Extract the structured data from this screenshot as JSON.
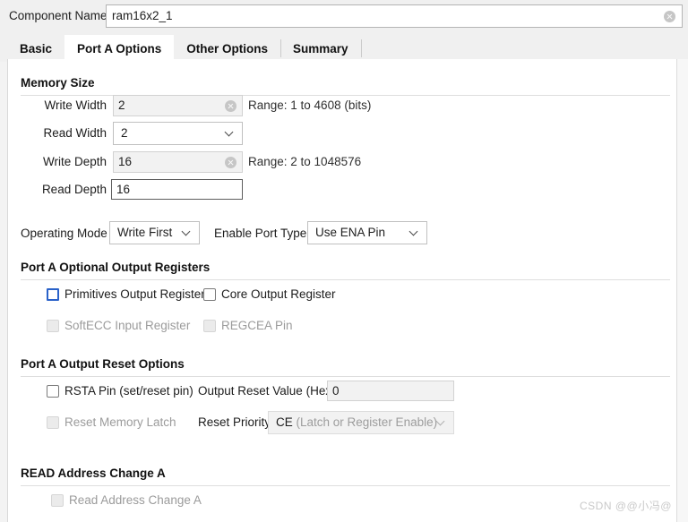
{
  "component": {
    "label": "Component Name",
    "value": "ram16x2_1",
    "clear_icon": "clear-circle-icon"
  },
  "tabs": [
    {
      "label": "Basic",
      "active": false
    },
    {
      "label": "Port A Options",
      "active": true
    },
    {
      "label": "Other Options",
      "active": false
    },
    {
      "label": "Summary",
      "active": false
    }
  ],
  "memory_size": {
    "title": "Memory Size",
    "write_width": {
      "label": "Write Width",
      "value": "2",
      "range": "Range: 1 to 4608 (bits)"
    },
    "read_width": {
      "label": "Read Width",
      "value": "2"
    },
    "write_depth": {
      "label": "Write Depth",
      "value": "16",
      "range": "Range: 2 to 1048576"
    },
    "read_depth": {
      "label": "Read Depth",
      "value": "16"
    }
  },
  "operating": {
    "mode_label": "Operating Mode",
    "mode_value": "Write First",
    "enable_label": "Enable Port Type",
    "enable_value": "Use ENA Pin"
  },
  "optional_registers": {
    "title": "Port A Optional Output Registers",
    "items": [
      {
        "label": "Primitives Output Register",
        "checked": false,
        "enabled": true,
        "focused": true
      },
      {
        "label": "Core Output Register",
        "checked": false,
        "enabled": true,
        "focused": false
      },
      {
        "label": "SoftECC Input Register",
        "checked": false,
        "enabled": false,
        "focused": false
      },
      {
        "label": "REGCEA Pin",
        "checked": false,
        "enabled": false,
        "focused": false
      }
    ]
  },
  "reset_options": {
    "title": "Port A Output Reset Options",
    "rsta_label": "RSTA Pin (set/reset pin)",
    "reset_memory_latch_label": "Reset Memory Latch",
    "output_reset_value_label": "Output Reset Value (Hex)",
    "output_reset_value": "0",
    "reset_priority_label": "Reset Priority",
    "reset_priority_value": "CE",
    "reset_priority_value_dim": " (Latch or Register Enable)"
  },
  "read_address_change": {
    "title": "READ Address Change A",
    "checkbox_label": "Read Address Change A"
  },
  "watermark": "CSDN @@小冯@",
  "colors": {
    "focus_blue": "#2a62c9",
    "panel_bg": "#ffffff",
    "chrome_bg": "#f0f0f0",
    "disabled_text": "#9b9b9b"
  }
}
